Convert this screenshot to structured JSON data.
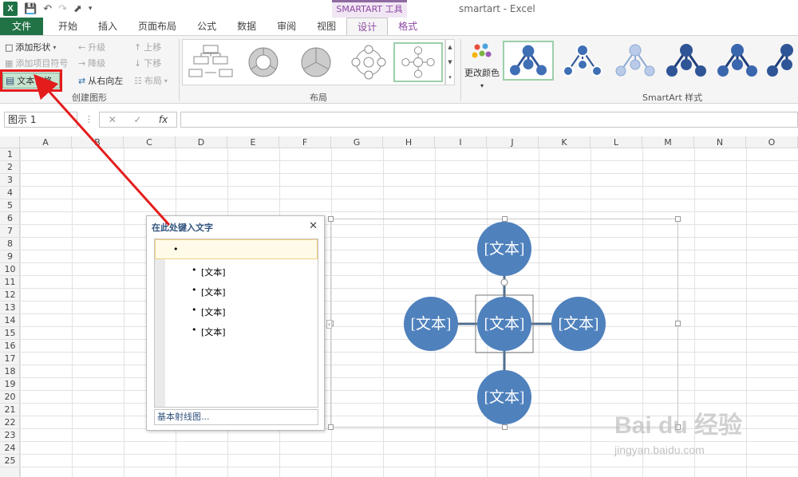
{
  "window": {
    "title": "smartart - Excel",
    "context_group": "SMARTART 工具"
  },
  "tabs": [
    {
      "label": "文件"
    },
    {
      "label": "开始"
    },
    {
      "label": "插入"
    },
    {
      "label": "页面布局"
    },
    {
      "label": "公式"
    },
    {
      "label": "数据"
    },
    {
      "label": "审阅"
    },
    {
      "label": "视图"
    },
    {
      "label": "设计"
    },
    {
      "label": "格式"
    }
  ],
  "ribbon": {
    "create_graphic": {
      "label": "创建图形",
      "add_shape": "添加形状",
      "add_bullet": "添加项目符号",
      "text_pane": "文本窗格",
      "promote": "升级",
      "demote": "降级",
      "right_to_left": "从右向左",
      "move_up": "上移",
      "move_down": "下移",
      "layout": "布局"
    },
    "layouts": {
      "label": "布局"
    },
    "smartart_styles": {
      "label": "SmartArt 样式",
      "change_colors": "更改颜色"
    }
  },
  "formula_bar": {
    "name_box": "图示 1",
    "formula": ""
  },
  "columns": [
    "A",
    "B",
    "C",
    "D",
    "E",
    "F",
    "G",
    "H",
    "I",
    "J",
    "K",
    "L",
    "M",
    "N",
    "O"
  ],
  "rows": [
    "1",
    "2",
    "3",
    "4",
    "5",
    "6",
    "7",
    "8",
    "9",
    "10",
    "11",
    "12",
    "13",
    "14",
    "15",
    "16",
    "17",
    "18",
    "19",
    "20",
    "21",
    "22",
    "23",
    "24",
    "25"
  ],
  "text_pane": {
    "title": "在此处键入文字",
    "items": [
      "",
      "[文本]",
      "[文本]",
      "[文本]",
      "[文本]"
    ],
    "footer": "基本射线图..."
  },
  "smartart": {
    "center": "[文本]",
    "top": "[文本]",
    "left": "[文本]",
    "right": "[文本]",
    "bottom": "[文本]"
  },
  "watermark": {
    "logo": "Bai du 经验",
    "url": "jingyan.baidu.com"
  },
  "colors": {
    "excel_green": "#217346",
    "node_fill": "#4f81bd",
    "context_purple": "#8e47a4",
    "highlight_red": "#e41c1c"
  }
}
